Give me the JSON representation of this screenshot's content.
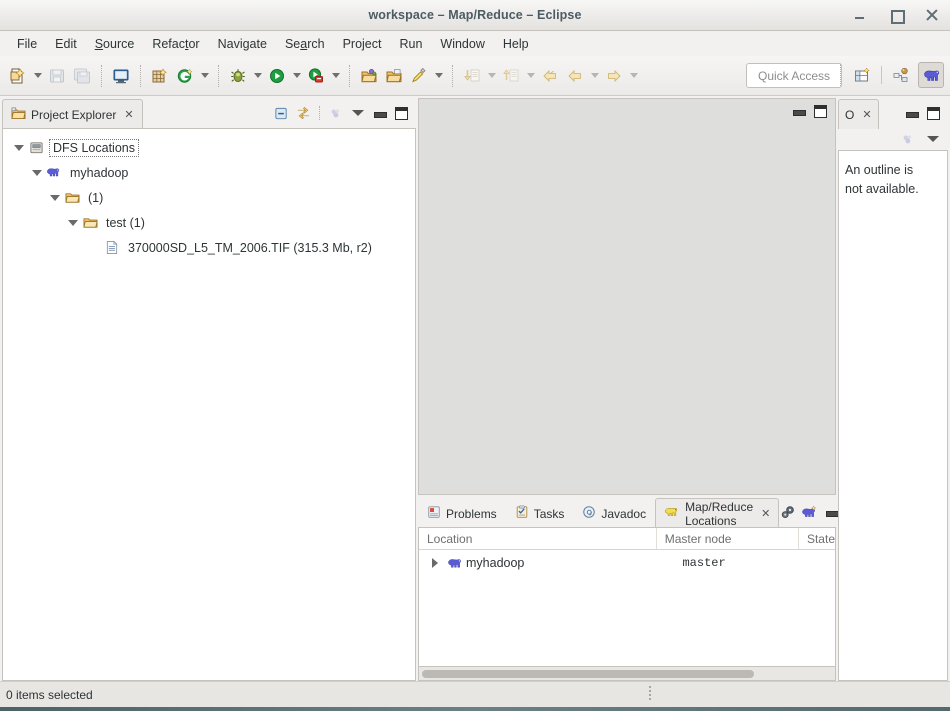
{
  "window": {
    "title": "workspace – Map/Reduce – Eclipse",
    "buttons": {
      "minimize": "minimize",
      "maximize": "maximize",
      "close": "close"
    }
  },
  "menubar": {
    "items": [
      {
        "label": "File",
        "mnemonic": ""
      },
      {
        "label": "Edit",
        "mnemonic": ""
      },
      {
        "label": "Source",
        "mnemonic": "S"
      },
      {
        "label": "Refactor",
        "mnemonic": "t"
      },
      {
        "label": "Navigate",
        "mnemonic": ""
      },
      {
        "label": "Search",
        "mnemonic": "a"
      },
      {
        "label": "Project",
        "mnemonic": ""
      },
      {
        "label": "Run",
        "mnemonic": ""
      },
      {
        "label": "Window",
        "mnemonic": ""
      },
      {
        "label": "Help",
        "mnemonic": ""
      }
    ]
  },
  "toolbar": {
    "quick_access_placeholder": "Quick Access",
    "buttons": [
      "new-wizard-icon",
      "save-icon",
      "save-all-icon",
      "console-icon",
      "new-package-icon",
      "new-java-class-icon",
      "debug-icon",
      "run-icon",
      "run-coverage-icon",
      "open-type-icon",
      "open-task-icon",
      "toggle-markers-icon",
      "next-annotation-icon",
      "previous-annotation-icon",
      "back-icon",
      "forward-icon"
    ],
    "perspective": {
      "open_perspective": "open-perspective-icon",
      "java_perspective": "java-perspective-icon",
      "mapreduce_perspective": "mapreduce-perspective-icon",
      "active": "mapreduce-perspective-icon"
    }
  },
  "project_explorer": {
    "tab_label": "Project Explorer",
    "close_glyph": "✕",
    "tools": [
      "collapse-all-icon",
      "link-with-editor-icon",
      "focus-icon",
      "view-menu-icon",
      "minimize-icon",
      "maximize-icon"
    ],
    "tree": [
      {
        "label": "DFS Locations",
        "depth": 0,
        "twisty": "open",
        "icon": "dfs-locations-icon",
        "focused": true
      },
      {
        "label": "myhadoop",
        "depth": 1,
        "twisty": "open",
        "icon": "hadoop-elephant-icon",
        "focused": false
      },
      {
        "label": "(1)",
        "depth": 2,
        "twisty": "open",
        "icon": "folder-icon",
        "focused": false
      },
      {
        "label": "test (1)",
        "depth": 3,
        "twisty": "open",
        "icon": "folder-icon",
        "focused": false
      },
      {
        "label": "370000SD_L5_TM_2006.TIF (315.3 Mb, r2)",
        "depth": 4,
        "twisty": "none",
        "icon": "file-icon",
        "focused": false
      }
    ]
  },
  "editor_area": {
    "minimize": "minimize-icon",
    "maximize": "maximize-icon",
    "content": ""
  },
  "outline": {
    "tab_label": "O",
    "close_glyph": "✕",
    "tools": [
      "focus-icon",
      "view-menu-icon"
    ],
    "minimize": "minimize-icon",
    "maximize": "maximize-icon",
    "message_line1": "An outline is",
    "message_line2": "not available."
  },
  "bottom_view": {
    "tabs": [
      {
        "label": "Problems",
        "icon": "problems-icon",
        "active": false
      },
      {
        "label": "Tasks",
        "icon": "tasks-icon",
        "active": false
      },
      {
        "label": "Javadoc",
        "icon": "javadoc-icon",
        "active": false
      },
      {
        "label": "Map/Reduce Locations",
        "icon": "mapreduce-locations-icon",
        "active": true
      }
    ],
    "close_glyph": "✕",
    "tools": [
      "edit-hadoop-location-icon",
      "new-hadoop-location-icon",
      "minimize-icon",
      "maximize-icon"
    ],
    "table": {
      "columns": [
        "Location",
        "Master node",
        "State"
      ],
      "rows": [
        {
          "location": "myhadoop",
          "master_node": "master",
          "state": "",
          "icon": "hadoop-elephant-icon",
          "twisty": "closed"
        }
      ]
    },
    "scrollbar": "horizontal-scrollbar"
  },
  "statusbar": {
    "text": "0 items selected"
  },
  "colors": {
    "window_chrome": "#f2f1f0",
    "panel_border": "#c6c2bd",
    "editor_background": "#dededd",
    "title_text": "#4b5c63",
    "hadoop_blue": "#5b5bd6",
    "folder_orange": "#e8a33d"
  }
}
